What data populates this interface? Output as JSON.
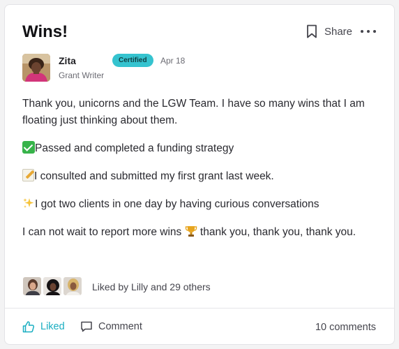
{
  "post": {
    "title": "Wins!",
    "share_label": "Share",
    "more_icon": "more-horizontal-icon",
    "bookmark_icon": "bookmark-icon"
  },
  "author": {
    "name": "Zita",
    "role": "Grant Writer",
    "badge": "Certified",
    "date": "Apr 18"
  },
  "body": {
    "p1": "Thank you, unicorns and the LGW Team. I have so many wins that I am floating just thinking about them.",
    "p2": "Passed and completed a funding strategy",
    "p3": "I consulted and submitted my first grant last week.",
    "p4": "I got two clients in one day by having curious conversations",
    "p5a": "I can not wait to report more wins ",
    "p5b": " thank you, thank you, thank you."
  },
  "likes": {
    "text": "Liked by Lilly and 29 others"
  },
  "footer": {
    "liked_label": "Liked",
    "comment_label": "Comment",
    "comments_count": "10 comments"
  },
  "colors": {
    "accent": "#1aaec1",
    "badge_bg": "#35c3cf"
  }
}
